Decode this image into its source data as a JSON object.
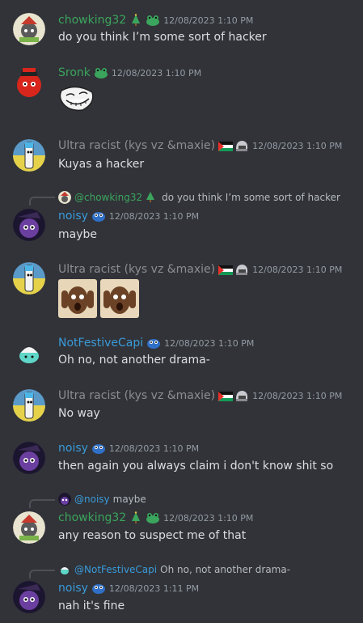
{
  "colors": {
    "background": "#313338",
    "green_name": "#3ba55d",
    "blue_name": "#3a9ad9",
    "gray_name": "#8b8d92",
    "bright_green_name": "#3ba55d"
  },
  "messages": [
    {
      "username": "chowking32",
      "timestamp": "12/08/2023 1:10 PM",
      "text": "do you think I’m some sort of hacker"
    },
    {
      "username": "Sronk",
      "timestamp": "12/08/2023 1:10 PM",
      "text": ""
    },
    {
      "username": "Ultra racist (kys vz &maxie)",
      "timestamp": "12/08/2023 1:10 PM",
      "text": "Kuyas a hacker"
    },
    {
      "reply_to": "@chowking32",
      "reply_text": "do you think I’m some sort of hacker",
      "username": "noisy",
      "timestamp": "12/08/2023 1:10 PM",
      "text": "maybe"
    },
    {
      "username": "Ultra racist (kys vz &maxie)",
      "timestamp": "12/08/2023 1:10 PM",
      "text": ""
    },
    {
      "username": "NotFestiveCapi",
      "timestamp": "12/08/2023 1:10 PM",
      "text": "Oh no, not another drama-"
    },
    {
      "username": "Ultra racist (kys vz &maxie)",
      "timestamp": "12/08/2023 1:10 PM",
      "text": "No way"
    },
    {
      "username": "noisy",
      "timestamp": "12/08/2023 1:10 PM",
      "text": "then again you always claim i don't know shit so"
    },
    {
      "reply_to": "@noisy",
      "reply_text": "maybe",
      "username": "chowking32",
      "timestamp": "12/08/2023 1:10 PM",
      "text": "any reason to suspect me of that"
    },
    {
      "reply_to": "@NotFestiveCapi",
      "reply_text": "Oh no, not another drama-",
      "username": "noisy",
      "timestamp": "12/08/2023 1:11 PM",
      "text": "nah it's fine"
    }
  ],
  "icons": {
    "tree_badge": "christmas-tree-icon",
    "frog_badge": "frog-icon",
    "flag_badge": "palestine-flag-icon",
    "helmet_badge": "helmet-icon",
    "blue_badge": "blue-creature-icon",
    "troll": "trollface-emoji",
    "image": "shocked-face-image"
  }
}
